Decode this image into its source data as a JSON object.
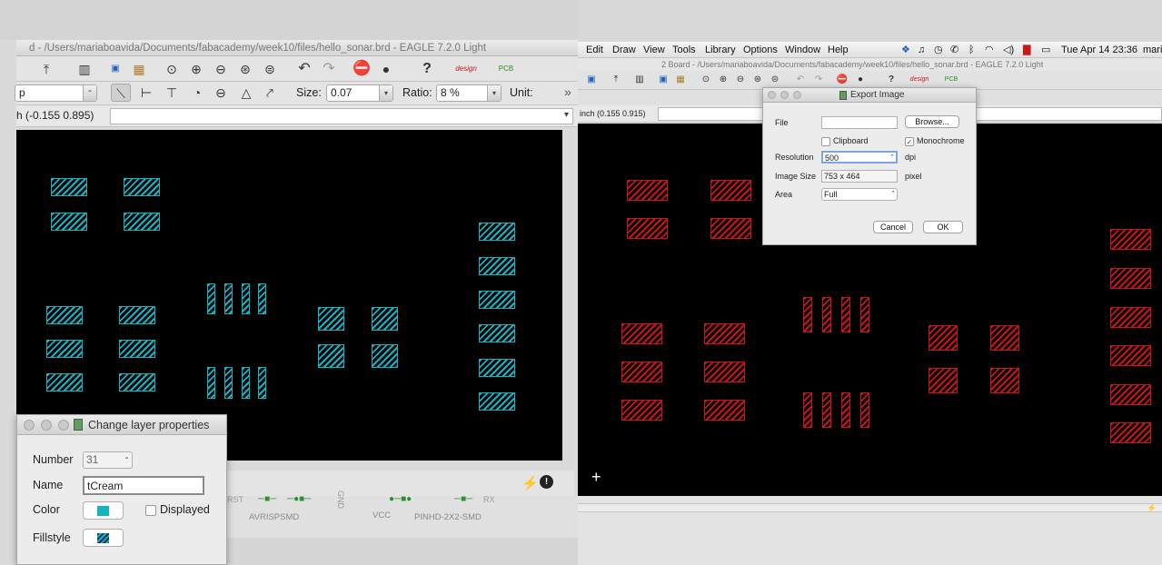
{
  "left": {
    "title": "d - /Users/mariaboavida/Documents/fabacademy/week10/files/hello_sonar.brd - EAGLE 7.2.0 Light",
    "layer_combo": "p",
    "size_label": "Size:",
    "size_value": "0.07",
    "ratio_label": "Ratio:",
    "ratio_value": "8 %",
    "unit_label": "Unit:",
    "more_glyph": "»",
    "coordinates": "h (-0.155 0.895)",
    "schematic_labels": [
      "AVRISPSMD",
      "VCC",
      "PINHD-2X2-SMD",
      "GND",
      "RST",
      "RX"
    ],
    "status_icons": [
      "lightning-icon",
      "stop-info-icon"
    ]
  },
  "layer_dialog": {
    "title": "Change layer properties",
    "number_label": "Number",
    "number_value": "31",
    "name_label": "Name",
    "name_value": "tCream",
    "color_label": "Color",
    "displayed_label": "Displayed",
    "displayed_checked": false,
    "fillstyle_label": "Fillstyle",
    "color_hex": "#13b5c4"
  },
  "menubar": {
    "items": [
      "Edit",
      "Draw",
      "View",
      "Tools",
      "Library",
      "Options",
      "Window",
      "Help"
    ],
    "clock": "Tue Apr 14  23:36",
    "user": "mari"
  },
  "right": {
    "title": "2 Board - /Users/mariaboavida/Documents/fabacademy/week10/files/hello_sonar.brd - EAGLE 7.2.0 Light",
    "coordinates": "inch (0.155 0.915)",
    "pad_color": "#c8161c"
  },
  "export_dialog": {
    "title": "Export Image",
    "file_label": "File",
    "file_value": "",
    "browse_label": "Browse...",
    "clipboard_label": "Clipboard",
    "clipboard_checked": false,
    "monochrome_label": "Monochrome",
    "monochrome_checked": true,
    "resolution_label": "Resolution",
    "resolution_value": "500",
    "resolution_unit": "dpi",
    "image_size_label": "Image Size",
    "image_size_value": "753 x 464",
    "image_size_unit": "pixel",
    "area_label": "Area",
    "area_value": "Full",
    "cancel_label": "Cancel",
    "ok_label": "OK"
  }
}
